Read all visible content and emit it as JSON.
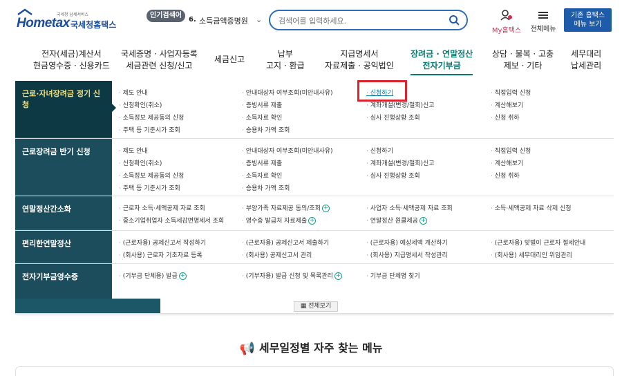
{
  "header": {
    "logo_brand": "Hometax",
    "logo_sub": "국세청 납세서비스",
    "logo_kr": "국세청홈택스",
    "popular_badge": "인기검색어",
    "popular_num": "6.",
    "popular_text": "소득금액증명원",
    "search_placeholder": "검색어를 입력하세요.",
    "my_label": "My홈택스",
    "all_menu_label": "전체메뉴",
    "legacy_line1": "기존 홈택스",
    "legacy_line2": "메뉴 보기"
  },
  "nav": [
    {
      "line1": "전자(세금)계산서",
      "line2": "현금영수증 · 신용카드"
    },
    {
      "line1": "국세증명 · 사업자등록",
      "line2": "세금관련 신청/신고"
    },
    {
      "line1": "세금신고",
      "line2": ""
    },
    {
      "line1": "납부",
      "line2": "고지 · 환급"
    },
    {
      "line1": "지급명세서",
      "line2": "자료제출 · 공익법인"
    },
    {
      "line1": "장려금 · 연말정산",
      "line2": "전자기부금"
    },
    {
      "line1": "상담 · 불복 · 고충",
      "line2": "제보 · 기타"
    },
    {
      "line1": "세무대리",
      "line2": "납세관리"
    }
  ],
  "menu": {
    "rows": [
      {
        "label": "근로·자녀장려금 정기 신청",
        "links": [
          [
            "제도 안내",
            "신청확인(취소)",
            "소득정보 제공동의 신청",
            "주택 등 기준시가 조회"
          ],
          [
            "안내대상자 여부조회(미안내사유)",
            "증빙서류 제출",
            "소득자료 확인",
            "승용차 가액 조회"
          ],
          [
            "신청하기",
            "계좌개설(변경/철회)신고",
            "심사 진행상황 조회"
          ],
          [
            "직접입력 신청",
            "계산해보기",
            "신청 취하"
          ]
        ]
      },
      {
        "label": "근로장려금 반기 신청",
        "links": [
          [
            "제도 안내",
            "신청확인(취소)",
            "소득정보 제공동의 신청",
            "주택 등 기준시가 조회"
          ],
          [
            "안내대상자 여부조회(미안내사유)",
            "증빙서류 제출",
            "소득자료 확인",
            "승용차 가액 조회"
          ],
          [
            "신청하기",
            "계좌개설(변경/철회)신고",
            "심사 진행상황 조회"
          ],
          [
            "직접입력 신청",
            "계산해보기",
            "신청 취하"
          ]
        ]
      },
      {
        "label": "연말정산간소화",
        "links": [
          [
            "근로자 소득·세액공제 자료 조회",
            "중소기업취업자 소득세감면명세서 조회"
          ],
          [
            "부양가족 자료제공 동의/조회",
            "영수증 발급처 자료제출"
          ],
          [
            "사업자 소득·세액공제 자료 조회",
            "연말정산 원클제공"
          ],
          [
            "소득·세액공제 자료 삭제 신청"
          ]
        ]
      },
      {
        "label": "편리한연말정산",
        "links": [
          [
            "(근로자용) 공제신고서 작성하기",
            "(회사용) 근로자 기초자료 등록"
          ],
          [
            "(근로자용) 공제신고서 제출하기",
            "(회사용) 공제신고서 관리"
          ],
          [
            "(근로자용) 예상세액 계산하기",
            "(회사용) 지급명세서 작성관리"
          ],
          [
            "(근로자용) 맞벌이 근로자 절세안내",
            "(회사용) 세무대리인 위임관리"
          ]
        ]
      },
      {
        "label": "전자기부금영수증",
        "links": [
          [
            "(기부금 단체용) 발급"
          ],
          [
            "(기부자용) 발급 신청 및 목록관리"
          ],
          [
            "기부금 단체명 찾기"
          ],
          []
        ]
      }
    ]
  },
  "bottom": {
    "see_all": "전체보기",
    "section_title": "세무일정별 자주 찾는 메뉴"
  },
  "colors": {
    "brand_blue": "#1e5ba8",
    "menu_dark": "#1b4d5c",
    "accent_teal": "#0a7a71",
    "highlight_red": "#d9232d"
  }
}
